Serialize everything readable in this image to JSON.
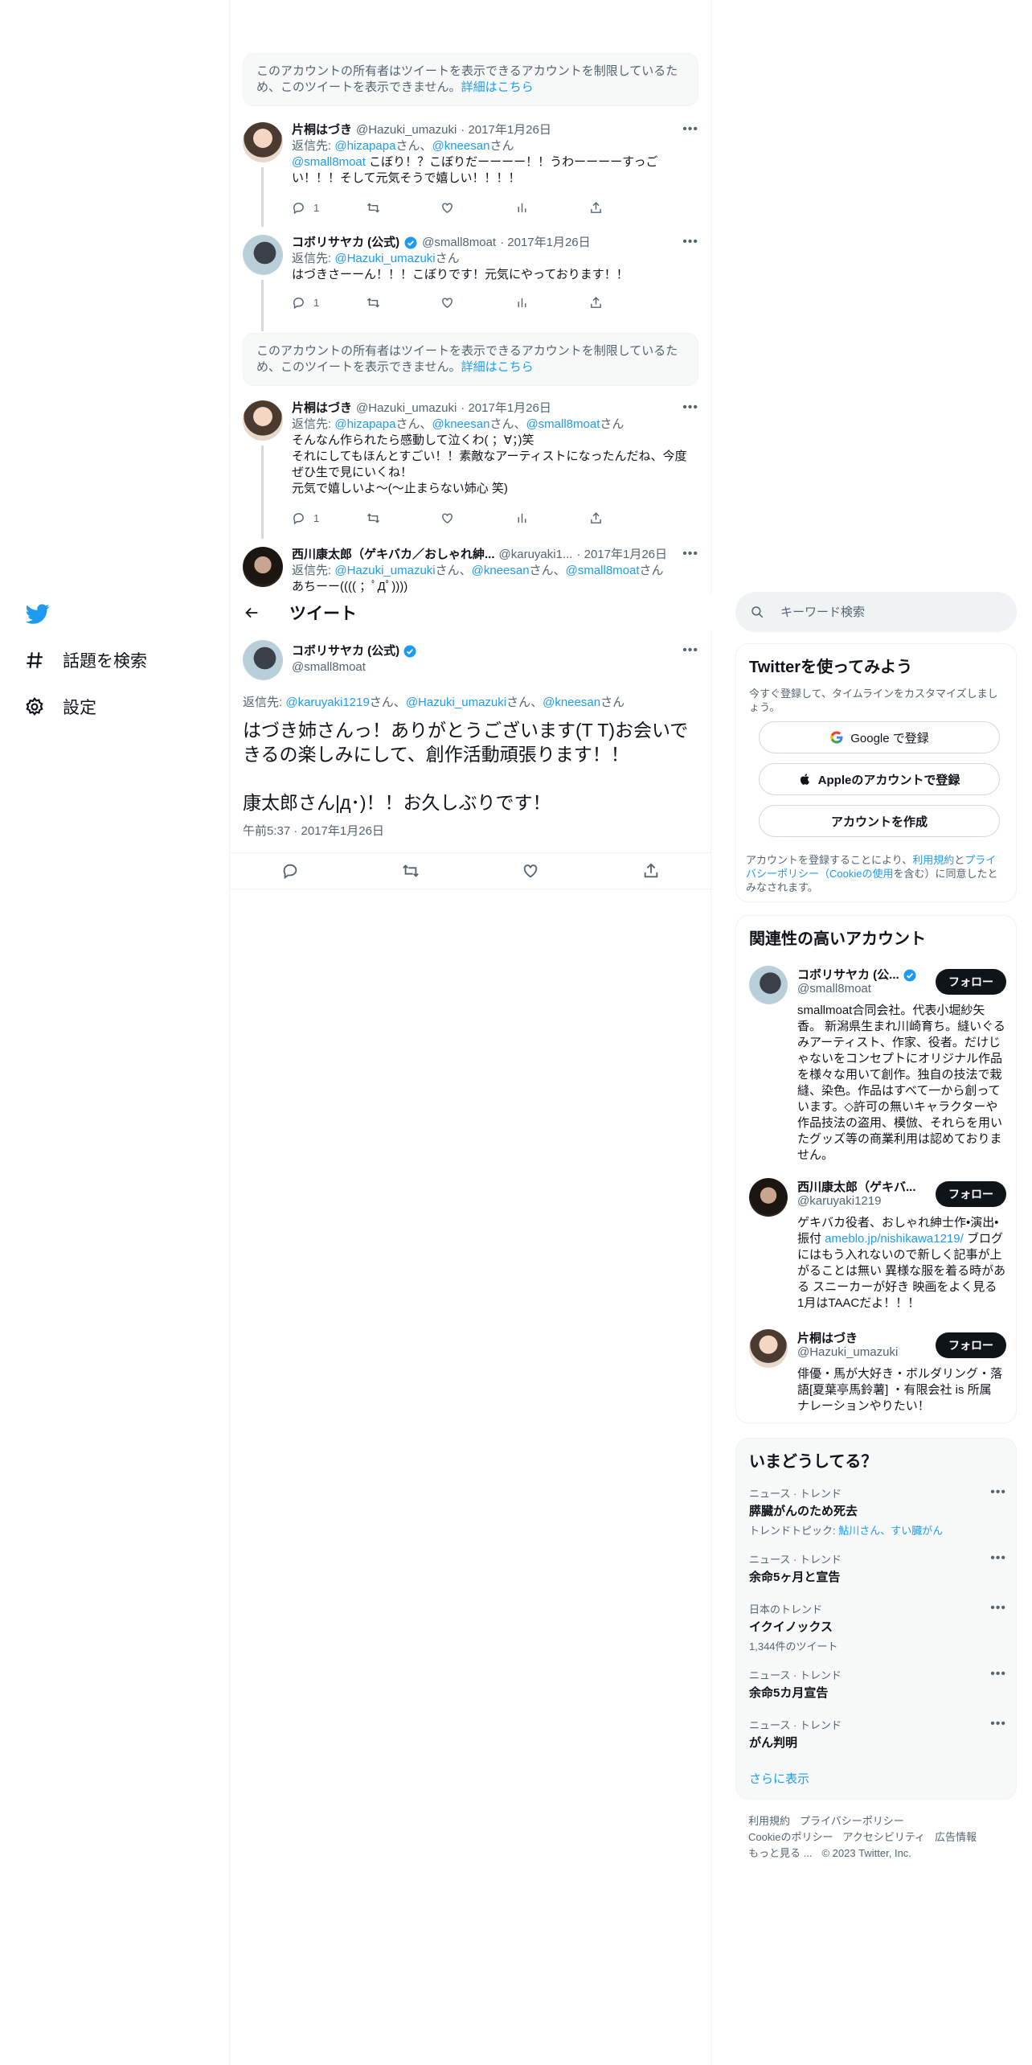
{
  "nav": {
    "items": [
      {
        "label": "話題を検索",
        "icon": "hashtag-icon"
      },
      {
        "label": "設定",
        "icon": "gear-icon"
      }
    ]
  },
  "notices": [
    {
      "text": "このアカウントの所有者はツイートを表示できるアカウントを制限しているため、このツイートを表示できません。",
      "link": "詳細はこちら"
    },
    {
      "text": "このアカウントの所有者はツイートを表示できるアカウントを制限しているため、このツイートを表示できません。",
      "link": "詳細はこちら"
    }
  ],
  "replies": [
    {
      "name": "片桐はづき",
      "handle": "@Hazuki_umazuki",
      "date": "· 2017年1月26日",
      "reply_prefix": "返信先: ",
      "reply_to": "@hizapapa",
      "reply_mid": "さん、",
      "reply_to2": "@kneesan",
      "reply_suffix": "さん",
      "mention": "@small8moat",
      "text": " こぼり！？こぼりだーーーー！！うわーーーーすっごい！！！そして元気そうで嬉しい！！！！",
      "replies_count": "1"
    },
    {
      "name": "コボリサヤカ (公式)",
      "handle": "@small8moat",
      "date": "· 2017年1月26日",
      "reply_prefix": "返信先: ",
      "reply_to": "@Hazuki_umazuki",
      "reply_suffix": "さん",
      "text": "はづきさーーん！！！こぼりです！元気にやっております！！",
      "replies_count": "1"
    },
    {
      "name": "片桐はづき",
      "handle": "@Hazuki_umazuki",
      "date": "· 2017年1月26日",
      "reply_prefix": "返信先: ",
      "reply_to": "@hizapapa",
      "reply_mid": "さん、",
      "reply_to2": "@kneesan",
      "reply_mid2": "さん、",
      "reply_to3": "@small8moat",
      "reply_suffix": "さん",
      "text": "そんなん作られたら感動して泣くわ( ；∀；)笑\nそれにしてもほんとすごい！！素敵なアーティストになったんだね、今度ぜひ生で見にいくね！\n元気で嬉しいよ〜(～止まらない姉心 笑)",
      "replies_count": "1"
    },
    {
      "name": "西川康太郎（ゲキバカ／おしゃれ紳...",
      "handle": "@karuyaki1...",
      "date": "· 2017年1月26日",
      "reply_prefix": "返信先: ",
      "reply_to": "@Hazuki_umazuki",
      "reply_mid": "さん、",
      "reply_to2": "@kneesan",
      "reply_mid2": "さん、",
      "reply_to3": "@small8moat",
      "reply_suffix": "さん",
      "text": "あちーー(((( ；ﾟДﾟ))))"
    }
  ],
  "topbar": {
    "title": "ツイート"
  },
  "main_tweet": {
    "name": "コボリサヤカ (公式)",
    "handle": "@small8moat",
    "reply_prefix": "返信先: ",
    "reply_to1": "@karuyaki1219",
    "reply_mid1": "さん、",
    "reply_to2": "@Hazuki_umazuki",
    "reply_mid2": "さん、",
    "reply_to3": "@kneesan",
    "reply_suffix": "さん",
    "text": "はづき姉さんっ！ありがとうございます(T T)お会いできるの楽しみにして、創作活動頑張ります！！\n\n康太郎さん|д･)！！お久しぶりです！",
    "time": "午前5:37 · 2017年1月26日"
  },
  "search": {
    "placeholder": "キーワード検索"
  },
  "signup": {
    "title": "Twitterを使ってみよう",
    "desc": "今すぐ登録して、タイムラインをカスタマイズしましょう。",
    "google": "Google で登録",
    "apple": "Appleのアカウントで登録",
    "create": "アカウントを作成",
    "legal_pre": "アカウントを登録することにより、",
    "legal_terms": "利用規約",
    "legal_and": "と",
    "legal_privacy": "プライバシーポリシー",
    "legal_cookie": "（Cookieの使用",
    "legal_post": "を含む）に同意したとみなされます。"
  },
  "related": {
    "title": "関連性の高いアカウント",
    "follow": "フォロー",
    "accounts": [
      {
        "name": "コボリサヤカ (公...",
        "handle": "@small8moat",
        "bio": "smallmoat合同会社。代表小堀紗矢香。 新潟県生まれ川崎育ち。縫いぐるみアーティスト、作家、役者。だけじゃないをコンセプトにオリジナル作品を様々な用いて創作。独自の技法で栽縫、染色。作品はすべて一から創っています。◇許可の無いキャラクターや作品技法の盗用、模倣、それらを用いたグッズ等の商業利用は認めておりません。"
      },
      {
        "name": "西川康太郎（ゲキバ...",
        "handle": "@karuyaki1219",
        "bio_pre": "ゲキバカ役者、おしゃれ紳士作•演出•振付 ",
        "bio_link": "ameblo.jp/nishikawa1219/",
        "bio_post": " ブログにはもう入れないので新しく記事が上がることは無い 異様な服を着る時がある スニーカーが好き 映画をよく見る 1月はTAACだよ！！！"
      },
      {
        "name": "片桐はづき",
        "handle": "@Hazuki_umazuki",
        "bio": "俳優・馬が大好き・ボルダリング・落語[夏葉亭馬鈴薯] ・有限会社 is 所属 ナレーションやりたい！"
      }
    ]
  },
  "trends": {
    "title": "いまどうしてる？",
    "items": [
      {
        "category": "ニュース · トレンド",
        "title": "膵臓がんのため死去",
        "sub_pre": "トレンドトピック: ",
        "sub_link": "鮎川さん、すい臓がん"
      },
      {
        "category": "ニュース · トレンド",
        "title": "余命5ヶ月と宣告"
      },
      {
        "category": "日本のトレンド",
        "title": "イクイノックス",
        "sub": "1,344件のツイート"
      },
      {
        "category": "ニュース · トレンド",
        "title": "余命5カ月宣告"
      },
      {
        "category": "ニュース · トレンド",
        "title": "がん判明"
      }
    ],
    "show_more": "さらに表示"
  },
  "footer": {
    "terms": "利用規約",
    "privacy": "プライバシーポリシー",
    "cookie": "Cookieのポリシー",
    "accessibility": "アクセシビリティ",
    "ads": "広告情報",
    "more": "もっと見る ...",
    "copyright": "© 2023 Twitter, Inc."
  }
}
